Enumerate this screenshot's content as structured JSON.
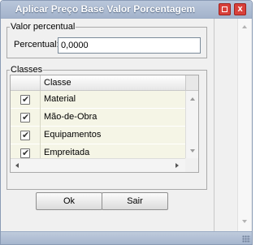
{
  "window": {
    "title": "Aplicar Preço Base Valor Porcentagem",
    "restore_icon": "restore-icon",
    "close_icon": "close-icon",
    "close_glyph": "x"
  },
  "valor_section": {
    "legend": "Valor percentual",
    "percentual_label": "Percentual:",
    "percentual_value": "0,0000"
  },
  "classes_section": {
    "legend": "Classes",
    "column_header": "Classe",
    "rows": [
      {
        "label": "Material",
        "checked": true
      },
      {
        "label": "Mão-de-Obra",
        "checked": true
      },
      {
        "label": "Equipamentos",
        "checked": true
      },
      {
        "label": "Empreitada",
        "checked": true
      }
    ]
  },
  "buttons": {
    "ok_label": "Ok",
    "sair_label": "Sair"
  },
  "colors": {
    "titlebar": "#a3b3cb",
    "close_button": "#d8403a",
    "row_background": "#f5f5e6"
  }
}
